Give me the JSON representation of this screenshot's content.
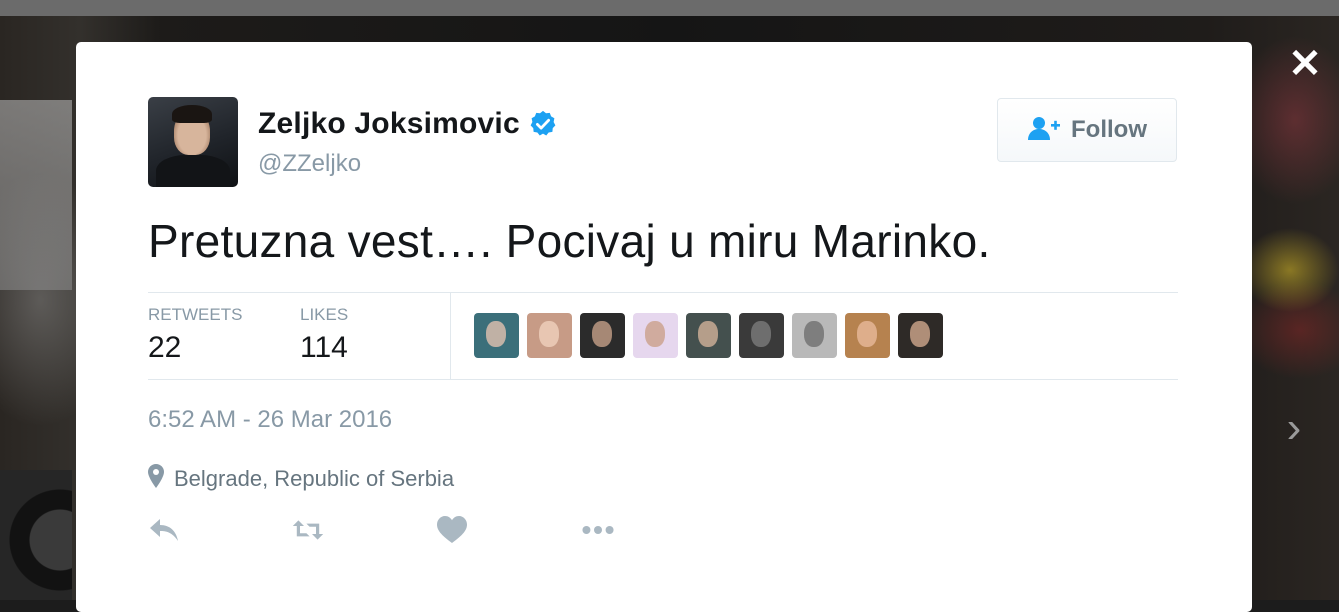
{
  "overlay": {
    "close_icon": "close-icon",
    "next_icon": "chevron-right-icon"
  },
  "tweet": {
    "author_name": "Zeljko Joksimovic",
    "author_handle": "@ZZeljko",
    "verified": true,
    "follow_label": "Follow",
    "text": "Pretuzna vest…. Pocivaj u miru Marinko.",
    "retweets_label": "RETWEETS",
    "retweets_count": "22",
    "likes_label": "LIKES",
    "likes_count": "114",
    "timestamp": "6:52 AM - 26 Mar 2016",
    "location": "Belgrade, Republic of Serbia",
    "actions": [
      "reply-icon",
      "retweet-icon",
      "like-icon",
      "more-icon"
    ]
  },
  "likers": [
    {
      "name": "liker-1",
      "bg": "#3b6f7a",
      "tone": "#e2c2b0"
    },
    {
      "name": "liker-2",
      "bg": "#c79b86",
      "tone": "#f0d1bd"
    },
    {
      "name": "liker-3",
      "bg": "#2b2b2b",
      "tone": "#c6a088"
    },
    {
      "name": "liker-4",
      "bg": "#e6d7ee",
      "tone": "#caa08a"
    },
    {
      "name": "liker-5",
      "bg": "#44504e",
      "tone": "#d2b29a"
    },
    {
      "name": "liker-6",
      "bg": "#3a3a3a",
      "tone": "#7c7c7c"
    },
    {
      "name": "liker-7",
      "bg": "#b9b9b9",
      "tone": "#6f6f6f"
    },
    {
      "name": "liker-8",
      "bg": "#b6824f",
      "tone": "#e8b99a"
    },
    {
      "name": "liker-9",
      "bg": "#2e2a27",
      "tone": "#cfa78d"
    }
  ],
  "colors": {
    "verified_blue": "#1da1f2",
    "follow_icon_blue": "#1da1f2",
    "muted_text": "#8899a6",
    "primary_text": "#14171a",
    "action_gray": "#aab8c2"
  }
}
